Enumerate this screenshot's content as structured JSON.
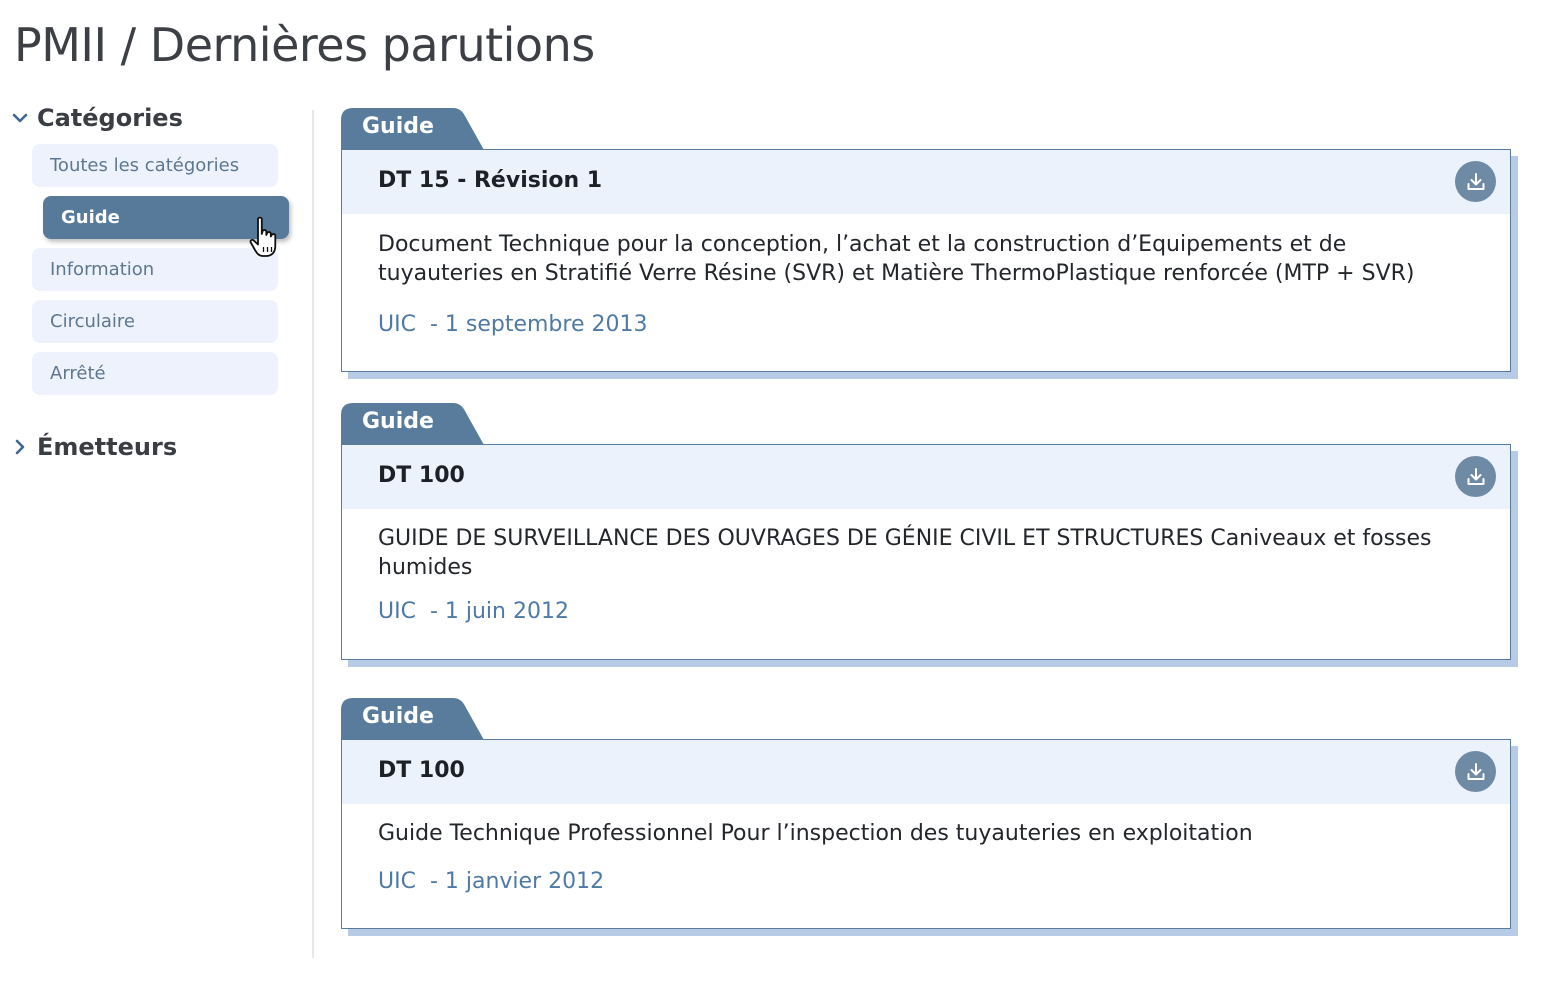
{
  "page": {
    "title": "PMII / Dernières parutions"
  },
  "sidebar": {
    "categories": {
      "label": "Catégories",
      "expanded": true,
      "items": [
        {
          "label": "Toutes les catégories",
          "active": false
        },
        {
          "label": "Guide",
          "active": true
        },
        {
          "label": "Information",
          "active": false
        },
        {
          "label": "Circulaire",
          "active": false
        },
        {
          "label": "Arrêté",
          "active": false
        }
      ]
    },
    "emitters": {
      "label": "Émetteurs",
      "expanded": false
    }
  },
  "publications": [
    {
      "category": "Guide",
      "title": "DT 15 - Révision 1",
      "description": "Document Technique pour la conception, l’achat et la construction d’Equipements et de tuyauteries en Stratifié Verre Résine (SVR) et Matière ThermoPlastique renforcée (MTP + SVR)",
      "meta": "UIC  - 1 septembre 2013"
    },
    {
      "category": "Guide",
      "title": "DT 100",
      "description": "GUIDE DE SURVEILLANCE DES OUVRAGES DE GÉNIE CIVIL ET STRUCTURES Caniveaux et fosses humides",
      "meta": "UIC  - 1 juin 2012"
    },
    {
      "category": "Guide",
      "title": "DT 100",
      "description": "Guide Technique Professionnel Pour l’inspection des tuyauteries en exploitation",
      "meta": "UIC  - 1 janvier 2012"
    }
  ],
  "icons": {
    "expanded_chevron": "chevron-down-icon",
    "collapsed_chevron": "chevron-right-icon",
    "download": "download-icon",
    "cursor": "hand-pointer-icon"
  },
  "colors": {
    "accent": "#587a9a",
    "tab": "#5a7c9c",
    "card_head_bg": "#ecf2fc",
    "card_shadow": "#b7cbe6",
    "meta_text": "#4f7aa6",
    "download_btn": "#6f8aa5"
  }
}
